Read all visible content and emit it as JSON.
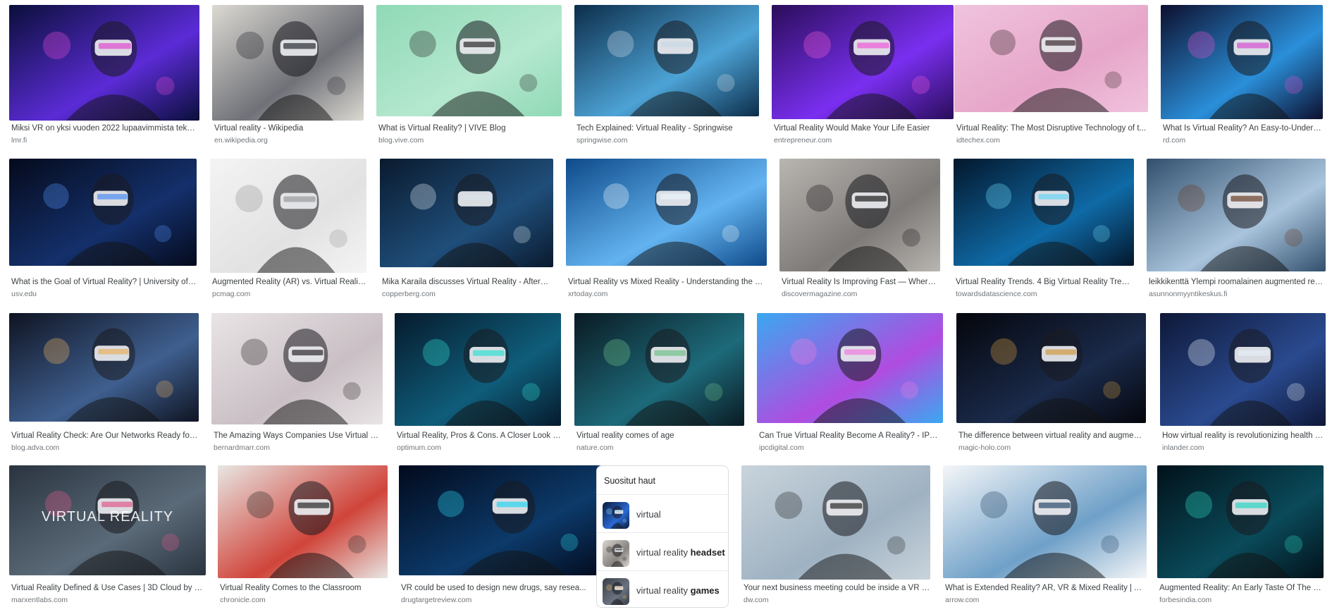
{
  "results": [
    {
      "caption": "Miksi VR on yksi vuoden 2022 lupaavimmista tekno...",
      "source": "lmr.fi",
      "palette": [
        "#0a0f3a",
        "#5b2bd6",
        "#e04bd0"
      ]
    },
    {
      "caption": "Virtual reality - Wikipedia",
      "source": "en.wikipedia.org",
      "palette": [
        "#dcd9d2",
        "#6f7178",
        "#2a2c33"
      ]
    },
    {
      "caption": "What is Virtual Reality? | VIVE Blog",
      "source": "blog.vive.com",
      "palette": [
        "#8fd9b6",
        "#b5e8cf",
        "#2a2a2a"
      ]
    },
    {
      "caption": "Tech Explained: Virtual Reality - Springwise",
      "source": "springwise.com",
      "palette": [
        "#0c2d4a",
        "#4da3d6",
        "#c9d8e4"
      ]
    },
    {
      "caption": "Virtual Reality Would Make Your Life Easier",
      "source": "entrepreneur.com",
      "palette": [
        "#2a0d5a",
        "#7a2ff0",
        "#f05ad8"
      ]
    },
    {
      "caption": "Virtual Reality: The Most Disruptive Technology of t...",
      "source": "idtechex.com",
      "palette": [
        "#f0c3dd",
        "#e6a6c9",
        "#3a2a2e"
      ]
    },
    {
      "caption": "What Is Virtual Reality? An Easy-to-Understa...",
      "source": "rd.com",
      "palette": [
        "#0d0f2e",
        "#2a8fd9",
        "#d64fd0"
      ]
    },
    {
      "caption": "What is the Goal of Virtual Reality? | University of S...",
      "source": "usv.edu",
      "palette": [
        "#050a1c",
        "#14306b",
        "#4f8ef2"
      ]
    },
    {
      "caption": "Augmented Reality (AR) vs. Virtual Reality ...",
      "source": "pcmag.com",
      "palette": [
        "#f4f4f4",
        "#e2e2e2",
        "#9a9a9a"
      ]
    },
    {
      "caption": "Mika Karaila discusses Virtual Reality - Afterm...",
      "source": "copperberg.com",
      "palette": [
        "#0a1a2e",
        "#1f4e7a",
        "#d8e3ea"
      ]
    },
    {
      "caption": "Virtual Reality vs Mixed Reality - Understanding the Dif...",
      "source": "xrtoday.com",
      "palette": [
        "#0e4a8a",
        "#63b3f0",
        "#e8f3fa"
      ]
    },
    {
      "caption": "Virtual Reality Is Improving Fast — Where I...",
      "source": "discovermagazine.com",
      "palette": [
        "#b9b6b1",
        "#7d7a78",
        "#1d1b1d"
      ]
    },
    {
      "caption": "Virtual Reality Trends. 4 Big Virtual Reality Trend...",
      "source": "towardsdatascience.com",
      "palette": [
        "#03172c",
        "#0f6aa6",
        "#69d4f5"
      ]
    },
    {
      "caption": "leikkikenttä Ylempi roomalainen augmented real...",
      "source": "asunnonmyyntikeskus.fi",
      "palette": [
        "#32506e",
        "#a9c4dc",
        "#6b3f2a"
      ]
    },
    {
      "caption": "Virtual Reality Check: Are Our Networks Ready for ...",
      "source": "blog.adva.com",
      "palette": [
        "#0f1422",
        "#3f5f8f",
        "#e8b060"
      ]
    },
    {
      "caption": "The Amazing Ways Companies Use Virtual Re...",
      "source": "bernardmarr.com",
      "palette": [
        "#e9e4e6",
        "#c9bfc4",
        "#2e2a2c"
      ]
    },
    {
      "caption": "Virtual Reality, Pros & Cons. A Closer Look at...",
      "source": "optimum.com",
      "palette": [
        "#061a2c",
        "#0f5d7a",
        "#32e0d4"
      ]
    },
    {
      "caption": "Virtual reality comes of age",
      "source": "nature.com",
      "palette": [
        "#0a1a22",
        "#1d6a7a",
        "#6fc28a"
      ]
    },
    {
      "caption": "Can True Virtual Reality Become A Reality? - IPC Di...",
      "source": "ipcdigital.com",
      "palette": [
        "#3aa8f0",
        "#b04ce0",
        "#f07ae0"
      ]
    },
    {
      "caption": "The difference between virtual reality and augment...",
      "source": "magic-holo.com",
      "palette": [
        "#05060c",
        "#1a2a4a",
        "#d09a40"
      ]
    },
    {
      "caption": "How virtual reality is revolutionizing health c...",
      "source": "inlander.com",
      "palette": [
        "#0e1838",
        "#2a4a8f",
        "#e4ecf6"
      ]
    },
    {
      "caption": "Virtual Reality Defined & Use Cases | 3D Cloud by Ma...",
      "source": "marxentlabs.com",
      "palette": [
        "#2a3440",
        "#5b6a78",
        "#e05a8a"
      ],
      "overlay": "VIRTUAL REALITY"
    },
    {
      "caption": "Virtual Reality Comes to the Classroom",
      "source": "chronicle.com",
      "palette": [
        "#e8e6e3",
        "#d0443a",
        "#2a2a2a"
      ]
    },
    {
      "caption": "VR could be used to design new drugs, say resea...",
      "source": "drugtargetreview.com",
      "palette": [
        "#020a1c",
        "#0c3a6a",
        "#2ad6f0"
      ]
    },
    {
      "caption": "Your next business meeting could be inside a VR h...",
      "source": "dw.com",
      "palette": [
        "#c9d4dc",
        "#9fb2c2",
        "#2a2a2a"
      ]
    },
    {
      "caption": "What is Extended Reality? AR, VR & Mixed Reality | Arro...",
      "source": "arrow.com",
      "palette": [
        "#f4f6f8",
        "#6fa0c8",
        "#2a4a6a"
      ]
    },
    {
      "caption": "Augmented Reality: An Early Taste Of The M...",
      "source": "forbesindia.com",
      "palette": [
        "#02121a",
        "#0a4a5a",
        "#2ad6c0"
      ]
    }
  ],
  "related_searches": {
    "title": "Suositut haut",
    "items": [
      {
        "prefix": "virtual",
        "bold": ""
      },
      {
        "prefix": "virtual reality ",
        "bold": "headset"
      },
      {
        "prefix": "virtual reality ",
        "bold": "games"
      }
    ]
  }
}
